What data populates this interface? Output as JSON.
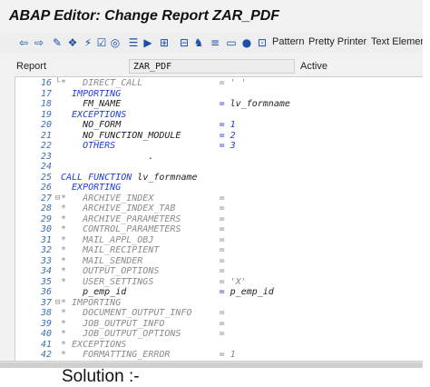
{
  "window": {
    "title": "ABAP Editor: Change Report ZAR_PDF"
  },
  "toolbar": {
    "icons": [
      {
        "name": "back-icon",
        "glyph": "⇦"
      },
      {
        "name": "forward-icon",
        "glyph": "⇨"
      },
      {
        "name": "display-change-icon",
        "glyph": "✎"
      },
      {
        "name": "other-object-icon",
        "glyph": "❖"
      },
      {
        "name": "activate-icon",
        "glyph": "⚡"
      },
      {
        "name": "check-icon",
        "glyph": "☑"
      },
      {
        "name": "where-used-icon",
        "glyph": "◎"
      },
      {
        "name": "object-list-icon",
        "glyph": "☰"
      },
      {
        "name": "test-icon",
        "glyph": "▶"
      },
      {
        "name": "hierarchy-icon",
        "glyph": "⊞"
      },
      {
        "name": "navigation-icon",
        "glyph": "⊟"
      },
      {
        "name": "tree-icon",
        "glyph": "♞"
      },
      {
        "name": "split-icon",
        "glyph": "≡"
      },
      {
        "name": "screen-icon",
        "glyph": "▭"
      },
      {
        "name": "breakpoint-icon",
        "glyph": "●"
      },
      {
        "name": "info-icon",
        "glyph": "⊡"
      },
      {
        "name": "delete-breakpoint-icon",
        "glyph": "⊗"
      }
    ],
    "pattern_label": "Pattern",
    "pretty_printer_label": "Pretty Printer",
    "text_elements_label": "Text Elements"
  },
  "report": {
    "label": "Report",
    "value": "ZAR_PDF",
    "status": "Active"
  },
  "code_lines": [
    {
      "num": "16",
      "marker": "└",
      "segments": [
        {
          "c": "cm",
          "t": "*   DIRECT_CALL              = ' '"
        }
      ]
    },
    {
      "num": "17",
      "marker": "",
      "segments": [
        {
          "c": "kw",
          "t": "  IMPORTING"
        }
      ]
    },
    {
      "num": "18",
      "marker": "",
      "segments": [
        {
          "c": "tx",
          "t": "    FM_NAME                  "
        },
        {
          "c": "op",
          "t": "= "
        },
        {
          "c": "tx",
          "t": "lv_formname"
        }
      ]
    },
    {
      "num": "19",
      "marker": "",
      "segments": [
        {
          "c": "kw",
          "t": "  EXCEPTIONS"
        }
      ]
    },
    {
      "num": "20",
      "marker": "",
      "segments": [
        {
          "c": "tx",
          "t": "    NO_FORM                  "
        },
        {
          "c": "op",
          "t": "= 1"
        }
      ]
    },
    {
      "num": "21",
      "marker": "",
      "segments": [
        {
          "c": "tx",
          "t": "    NO_FUNCTION_MODULE       "
        },
        {
          "c": "op",
          "t": "= 2"
        }
      ]
    },
    {
      "num": "22",
      "marker": "",
      "segments": [
        {
          "c": "kw",
          "t": "    OTHERS                   "
        },
        {
          "c": "op",
          "t": "= 3"
        }
      ]
    },
    {
      "num": "23",
      "marker": "",
      "segments": [
        {
          "c": "tx",
          "t": "                ."
        }
      ]
    },
    {
      "num": "24",
      "marker": "",
      "segments": [
        {
          "c": "tx",
          "t": ""
        }
      ]
    },
    {
      "num": "25",
      "marker": "",
      "segments": [
        {
          "c": "kw",
          "t": "CALL FUNCTION "
        },
        {
          "c": "tx",
          "t": "lv_formname"
        }
      ]
    },
    {
      "num": "26",
      "marker": "",
      "segments": [
        {
          "c": "kw",
          "t": "  EXPORTING"
        }
      ]
    },
    {
      "num": "27",
      "marker": "⊟",
      "segments": [
        {
          "c": "cm",
          "t": "*   ARCHIVE_INDEX            ="
        }
      ]
    },
    {
      "num": "28",
      "marker": "",
      "segments": [
        {
          "c": "cm",
          "t": "*   ARCHIVE_INDEX_TAB        ="
        }
      ]
    },
    {
      "num": "29",
      "marker": "",
      "segments": [
        {
          "c": "cm",
          "t": "*   ARCHIVE_PARAMETERS       ="
        }
      ]
    },
    {
      "num": "30",
      "marker": "",
      "segments": [
        {
          "c": "cm",
          "t": "*   CONTROL_PARAMETERS       ="
        }
      ]
    },
    {
      "num": "31",
      "marker": "",
      "segments": [
        {
          "c": "cm",
          "t": "*   MAIL_APPL_OBJ            ="
        }
      ]
    },
    {
      "num": "32",
      "marker": "",
      "segments": [
        {
          "c": "cm",
          "t": "*   MAIL_RECIPIENT           ="
        }
      ]
    },
    {
      "num": "33",
      "marker": "",
      "segments": [
        {
          "c": "cm",
          "t": "*   MAIL_SENDER              ="
        }
      ]
    },
    {
      "num": "34",
      "marker": "",
      "segments": [
        {
          "c": "cm",
          "t": "*   OUTPUT_OPTIONS           ="
        }
      ]
    },
    {
      "num": "35",
      "marker": "",
      "segments": [
        {
          "c": "cm",
          "t": "*   USER_SETTINGS            = 'X'"
        }
      ]
    },
    {
      "num": "36",
      "marker": "",
      "segments": [
        {
          "c": "tx",
          "t": "    p_emp_id                 "
        },
        {
          "c": "op",
          "t": "= "
        },
        {
          "c": "tx",
          "t": "p_emp_id"
        }
      ]
    },
    {
      "num": "37",
      "marker": "⊟",
      "segments": [
        {
          "c": "cm",
          "t": "* IMPORTING"
        }
      ]
    },
    {
      "num": "38",
      "marker": "",
      "segments": [
        {
          "c": "cm",
          "t": "*   DOCUMENT_OUTPUT_INFO     ="
        }
      ]
    },
    {
      "num": "39",
      "marker": "",
      "segments": [
        {
          "c": "cm",
          "t": "*   JOB_OUTPUT_INFO          ="
        }
      ]
    },
    {
      "num": "40",
      "marker": "",
      "segments": [
        {
          "c": "cm",
          "t": "*   JOB_OUTPUT_OPTIONS       ="
        }
      ]
    },
    {
      "num": "41",
      "marker": "",
      "segments": [
        {
          "c": "cm",
          "t": "* EXCEPTIONS"
        }
      ]
    },
    {
      "num": "42",
      "marker": "",
      "segments": [
        {
          "c": "cm",
          "t": "*   FORMATTING_ERROR         = 1"
        }
      ]
    }
  ],
  "caption": "Solution :-",
  "colors": {
    "keyword": "#1f3fcf",
    "comment": "#8a8a8a",
    "line_number": "#3a6fb0"
  }
}
